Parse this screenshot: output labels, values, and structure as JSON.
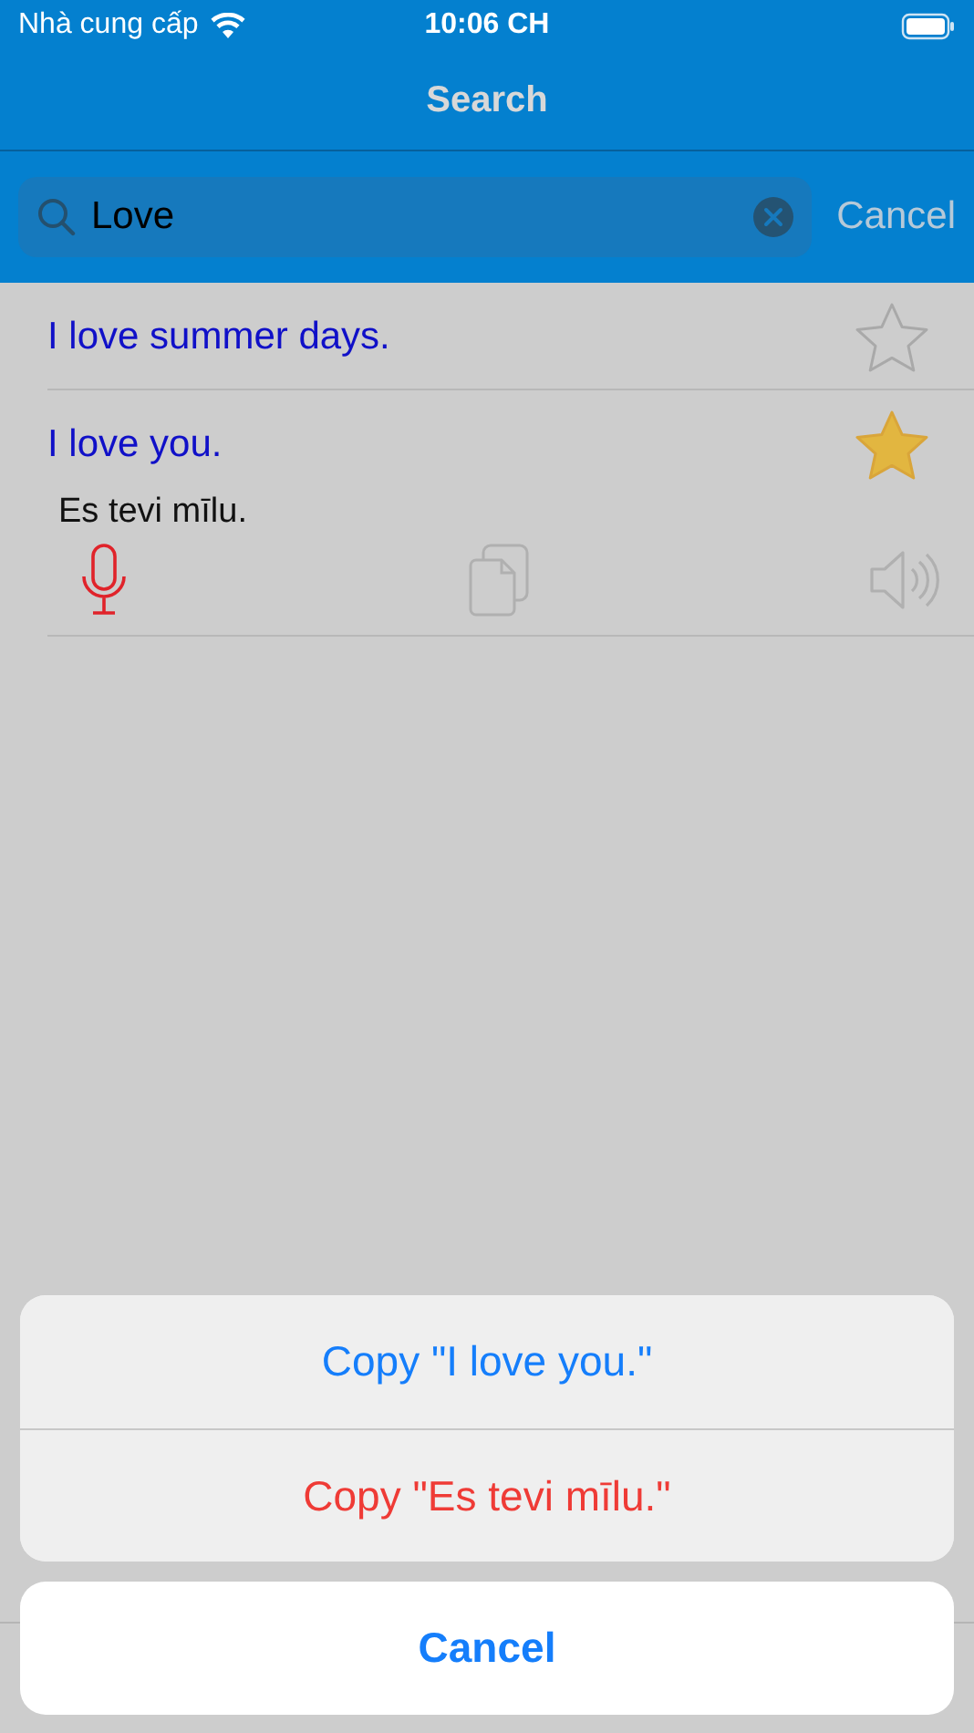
{
  "status_bar": {
    "carrier": "Nhà cung cấp",
    "time": "10:06 CH"
  },
  "nav": {
    "title": "Search"
  },
  "search": {
    "value": "Love",
    "cancel": "Cancel"
  },
  "results": [
    {
      "phrase": "I love summer days.",
      "starred": false
    },
    {
      "phrase": "I love you.",
      "starred": true,
      "translation": "Es tevi mīlu."
    }
  ],
  "action_sheet": {
    "actions": [
      {
        "label": "Copy \"I love you.\"",
        "kind": "default"
      },
      {
        "label": "Copy \"Es tevi mīlu.\"",
        "kind": "destructive"
      }
    ],
    "cancel": "Cancel"
  }
}
